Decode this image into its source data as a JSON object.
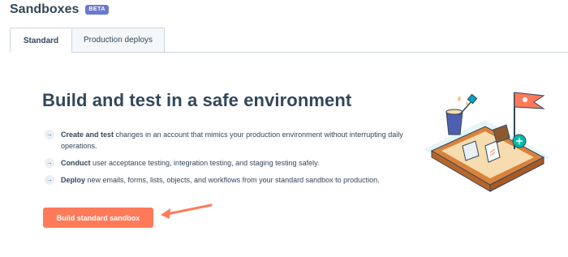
{
  "header": {
    "title": "Sandboxes",
    "badge": "BETA"
  },
  "tabs": [
    {
      "label": "Standard",
      "active": true
    },
    {
      "label": "Production deploys",
      "active": false
    }
  ],
  "main": {
    "heading": "Build and test in a safe environment",
    "features": [
      {
        "bold": "Create and test",
        "text": " changes in an account that mimics your production environment without interrupting daily operations."
      },
      {
        "bold": "Conduct",
        "text": " user acceptance testing, integration testing, and staging testing safely."
      },
      {
        "bold": "Deploy",
        "text": " new emails, forms, lists, objects, and workflows from your standard sandbox to production."
      }
    ],
    "bullet_glyph": "→",
    "cta_label": "Build standard sandbox"
  },
  "colors": {
    "accent": "#ff7a59",
    "text": "#33475b",
    "badge": "#6a78d1",
    "border": "#cbd6e2"
  },
  "icons": {
    "bullet": "arrow-right-icon",
    "annotation": "pointer-arrow-icon",
    "illustration": "sandbox-illustration"
  }
}
